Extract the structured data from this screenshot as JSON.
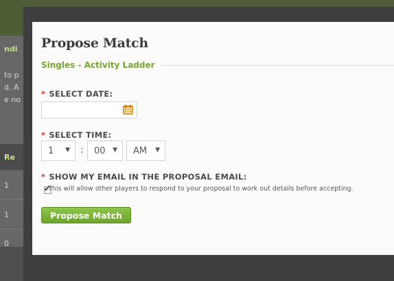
{
  "background": {
    "fragments": [
      "ndi",
      "to p",
      "d. A",
      "e no",
      "Re",
      "1",
      "1",
      "0"
    ]
  },
  "modal": {
    "title": "Propose Match",
    "subtitle": "Singles - Activity Ladder",
    "date": {
      "required_mark": "*",
      "label": "SELECT DATE:",
      "value": "",
      "icon": "calendar-icon"
    },
    "time": {
      "required_mark": "*",
      "label": "SELECT TIME:",
      "hour": "1",
      "separator": ":",
      "minute": "00",
      "meridiem": "AM"
    },
    "email": {
      "required_mark": "*",
      "label": "SHOW MY EMAIL IN THE PROPOSAL EMAIL:",
      "checked": true,
      "checkbox_text": "This will allow other players to respond to your proposal to work out details before accepting."
    },
    "submit_label": "Propose Match"
  },
  "colors": {
    "accent_green": "#76a62e",
    "button_green": "#7cb83a",
    "required_red": "#d23b2b",
    "calendar_orange": "#f0a637"
  }
}
